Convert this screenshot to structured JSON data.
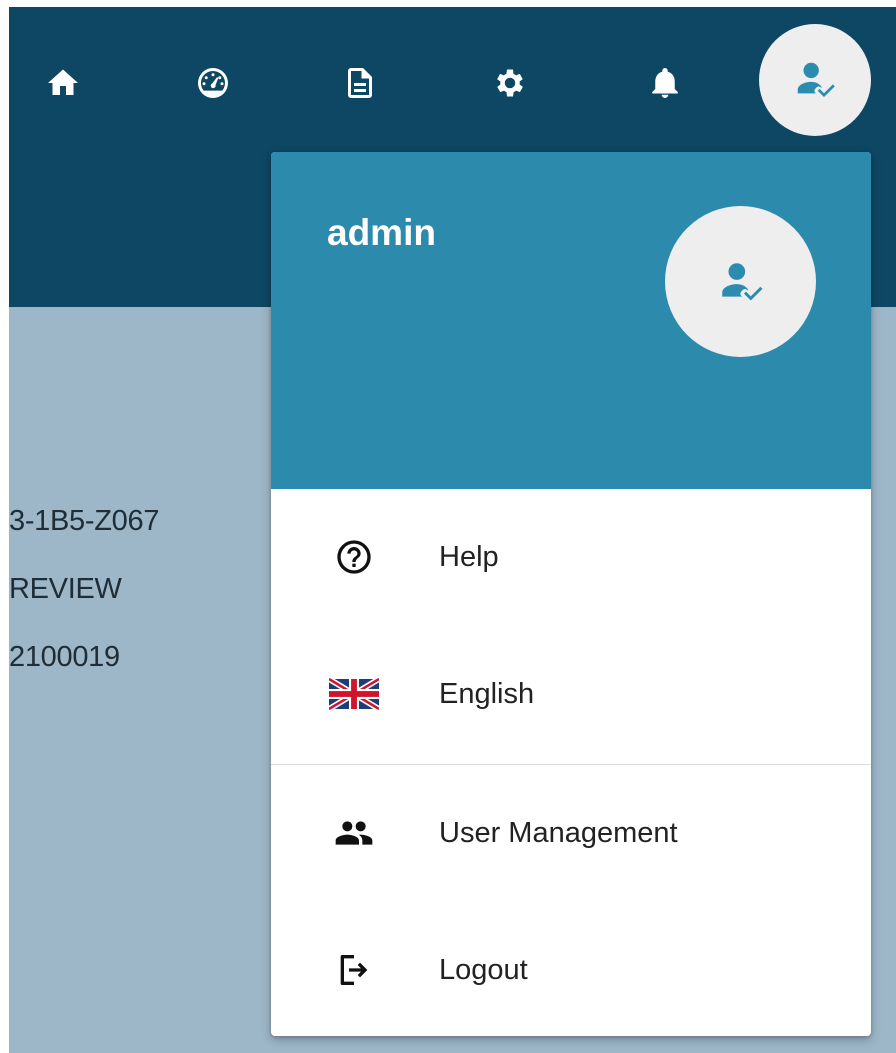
{
  "header": {
    "nav_icons": [
      "home-icon",
      "dashboard-icon",
      "document-icon",
      "settings-icon",
      "notification-bell-icon"
    ],
    "user_avatar_icon": "user-check-icon"
  },
  "background": {
    "lines": [
      "3-1B5-Z067",
      "REVIEW",
      "2100019"
    ]
  },
  "user_menu": {
    "username": "admin",
    "avatar_icon": "user-check-icon",
    "items": [
      {
        "label": "Help",
        "icon": "help-circle-icon"
      },
      {
        "label": "English",
        "icon": "uk-flag-icon"
      },
      {
        "label": "User Management",
        "icon": "users-icon"
      },
      {
        "label": "Logout",
        "icon": "logout-icon"
      }
    ]
  },
  "colors": {
    "header_bg": "#0d4763",
    "menu_header_bg": "#2c8aad",
    "body_bg": "#9db7c9",
    "avatar_bg": "#eeeeee"
  }
}
